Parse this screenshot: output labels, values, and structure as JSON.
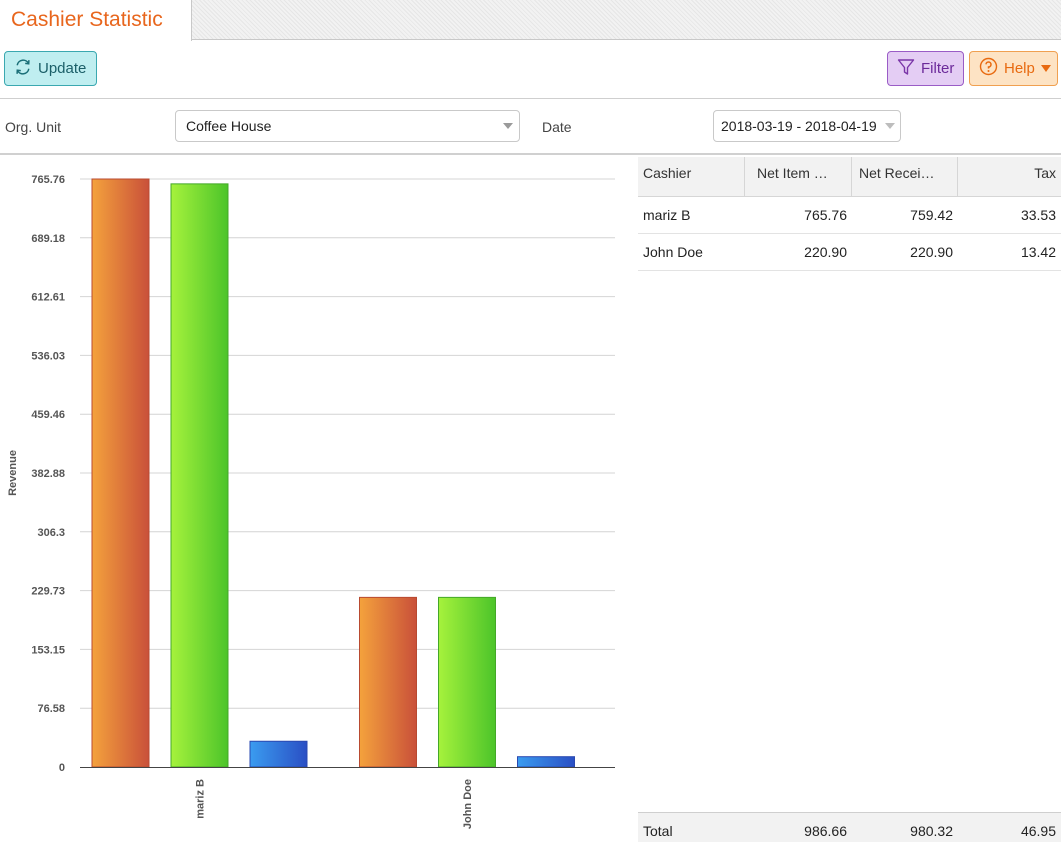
{
  "app": {
    "tab_title": "Cashier Statistic"
  },
  "toolbar": {
    "update_label": "Update",
    "filter_label": "Filter",
    "help_label": "Help"
  },
  "params": {
    "org_unit_label": "Org. Unit",
    "org_unit_value": "Coffee House",
    "date_label": "Date",
    "date_value": "2018-03-19 - 2018-04-19"
  },
  "colors": {
    "accent_orange": "#e8661d",
    "bar_orange_light": "#f4a23c",
    "bar_orange_dark": "#c9503a",
    "bar_green_light": "#a6f23c",
    "bar_green_dark": "#4cc42a",
    "bar_blue_light": "#3a9cf0",
    "bar_blue_dark": "#2a4fc4"
  },
  "chart_data": {
    "type": "bar",
    "ylabel": "Revenue",
    "xlabel": "",
    "categories": [
      "mariz B",
      "John Doe"
    ],
    "yticks": [
      "0",
      "76.58",
      "153.15",
      "229.73",
      "306.3",
      "382.88",
      "459.46",
      "536.03",
      "612.61",
      "689.18",
      "765.76"
    ],
    "ylim": [
      0,
      765.76
    ],
    "series": [
      {
        "values": [
          765.76,
          220.9
        ],
        "color": "orange"
      },
      {
        "values": [
          759.42,
          220.9
        ],
        "color": "green"
      },
      {
        "values": [
          33.53,
          13.42
        ],
        "color": "blue"
      }
    ],
    "grid": true
  },
  "table": {
    "columns": [
      "Cashier",
      "Net Item …",
      "Net Recei…",
      "Tax"
    ],
    "rows": [
      [
        "mariz B",
        "765.76",
        "759.42",
        "33.53"
      ],
      [
        "John Doe",
        "220.90",
        "220.90",
        "13.42"
      ]
    ],
    "footer": [
      "Total",
      "986.66",
      "980.32",
      "46.95"
    ]
  }
}
